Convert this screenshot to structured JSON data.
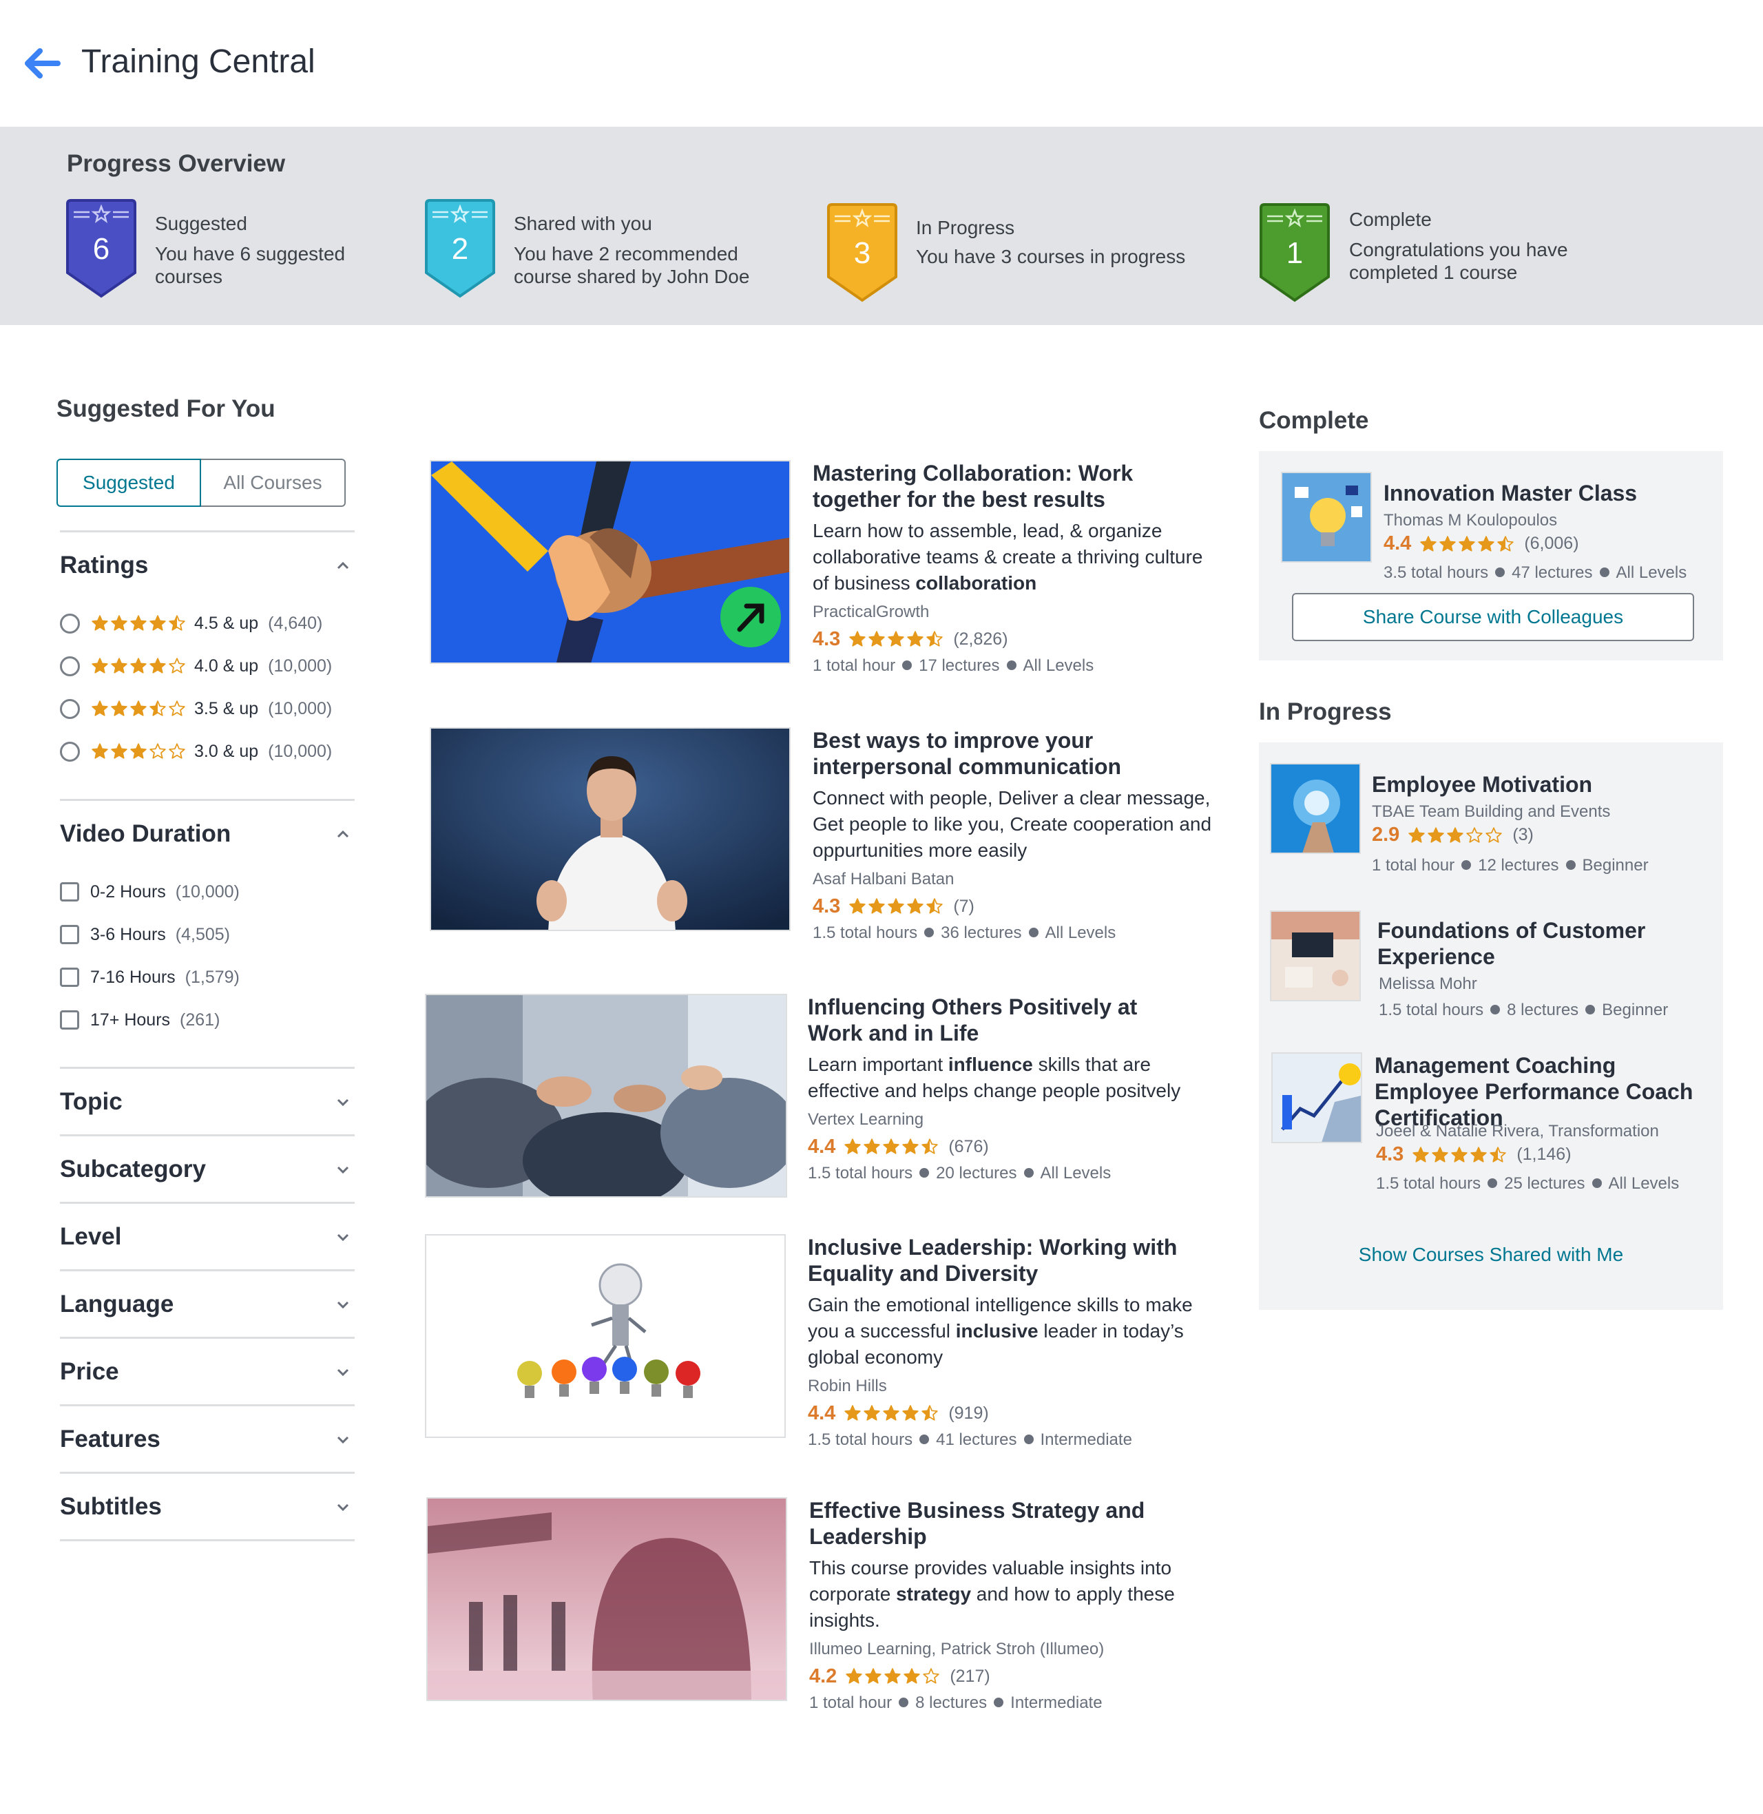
{
  "header": {
    "title": "Training Central"
  },
  "progress": {
    "title": "Progress Overview",
    "cards": [
      {
        "count": "6",
        "title": "Suggested",
        "desc": "You have 6 suggested courses",
        "color": "#4a4fc4"
      },
      {
        "count": "2",
        "title": "Shared with you",
        "desc": "You have 2 recommended course shared by John Doe",
        "color": "#3cc2de"
      },
      {
        "count": "3",
        "title": "In Progress",
        "desc": "You have 3 courses in progress",
        "color": "#f6b226"
      },
      {
        "count": "1",
        "title": "Complete",
        "desc": "Congratulations you have completed 1 course",
        "color": "#4c9c2e"
      }
    ]
  },
  "sidebar": {
    "heading": "Suggested For You",
    "toggle": {
      "suggested": "Suggested",
      "all": "All Courses"
    },
    "ratings": {
      "title": "Ratings",
      "options": [
        {
          "label": "4.5 & up",
          "count": "(4,640)",
          "stars": 4.5
        },
        {
          "label": "4.0 & up",
          "count": "(10,000)",
          "stars": 4.0
        },
        {
          "label": "3.5 & up",
          "count": "(10,000)",
          "stars": 3.5
        },
        {
          "label": "3.0 & up",
          "count": "(10,000)",
          "stars": 3.0
        }
      ]
    },
    "duration": {
      "title": "Video Duration",
      "options": [
        {
          "label": "0-2 Hours",
          "count": "(10,000)"
        },
        {
          "label": "3-6 Hours",
          "count": "(4,505)"
        },
        {
          "label": "7-16 Hours",
          "count": "(1,579)"
        },
        {
          "label": "17+ Hours",
          "count": "(261)"
        }
      ]
    },
    "collapsed": [
      "Topic",
      "Subcategory",
      "Level",
      "Language",
      "Price",
      "Features",
      "Subtitles"
    ]
  },
  "courses": [
    {
      "title": "Mastering Collaboration: Work together for the best results",
      "desc_html": "Learn how to assemble, lead, & organize collaborative teams & create a thriving culture of business <b>collaboration</b>",
      "author": "PracticalGrowth",
      "rating": "4.3",
      "stars": 4.5,
      "reviews": "(2,826)",
      "hours": "1 total hour",
      "lectures": "17 lectures",
      "level": "All Levels"
    },
    {
      "title": "Best ways to improve your interpersonal communication",
      "desc_html": "Connect with people, Deliver a clear message, Get people to like you, Create cooperation and oppurtunities more easily",
      "author": "Asaf Halbani Batan",
      "rating": "4.3",
      "stars": 4.5,
      "reviews": "(7)",
      "hours": "1.5 total hours",
      "lectures": "36 lectures",
      "level": "All Levels"
    },
    {
      "title": "Influencing Others Positively at Work and in Life",
      "desc_html": "Learn important <b>influence</b> skills that are effective and helps change people positvely",
      "author": "Vertex Learning",
      "rating": "4.4",
      "stars": 4.5,
      "reviews": "(676)",
      "hours": "1.5 total hours",
      "lectures": "20 lectures",
      "level": "All Levels"
    },
    {
      "title": "Inclusive Leadership: Working with Equality and Diversity",
      "desc_html": "Gain the emotional intelligence skills to make you a successful <b>inclusive</b> leader in today’s global economy",
      "author": "Robin Hills",
      "rating": "4.4",
      "stars": 4.5,
      "reviews": "(919)",
      "hours": "1.5 total hours",
      "lectures": "41 lectures",
      "level": "Intermediate"
    },
    {
      "title": "Effective Business Strategy and Leadership",
      "desc_html": "This course provides valuable insights into corporate <b>strategy</b> and how to apply these insights.",
      "author": "Illumeo Learning, Patrick Stroh (Illumeo)",
      "rating": "4.2",
      "stars": 4.0,
      "reviews": "(217)",
      "hours": "1 total hour",
      "lectures": "8 lectures",
      "level": "Intermediate"
    }
  ],
  "complete": {
    "heading": "Complete",
    "item": {
      "title": "Innovation Master Class",
      "author": "Thomas M Koulopoulos",
      "rating": "4.4",
      "stars": 4.5,
      "reviews": "(6,006)",
      "hours": "3.5 total hours",
      "lectures": "47 lectures",
      "level": "All Levels"
    },
    "share_label": "Share Course with Colleagues"
  },
  "in_progress": {
    "heading": "In Progress",
    "items": [
      {
        "title": "Employee Motivation",
        "author": "TBAE Team Building and Events",
        "rating": "2.9",
        "stars": 3.0,
        "reviews": "(3)",
        "hours": "1 total hour",
        "lectures": "12 lectures",
        "level": "Beginner"
      },
      {
        "title": "Foundations of Customer Experience",
        "author": "Melissa Mohr",
        "hours": "1.5 total hours",
        "lectures": "8 lectures",
        "level": "Beginner"
      },
      {
        "title": "Management Coaching Employee Performance Coach Certification",
        "author": "Joeel & Natalie Rivera, Transformation",
        "rating": "4.3",
        "stars": 4.5,
        "reviews": "(1,146)",
        "hours": "1.5 total hours",
        "lectures": "25 lectures",
        "level": "All Levels"
      }
    ],
    "show_link": "Show Courses Shared with Me"
  },
  "colors": {
    "accent": "#007791",
    "star": "#e59819",
    "rating": "#dc7b2b",
    "back_arrow": "#3b82f6"
  }
}
